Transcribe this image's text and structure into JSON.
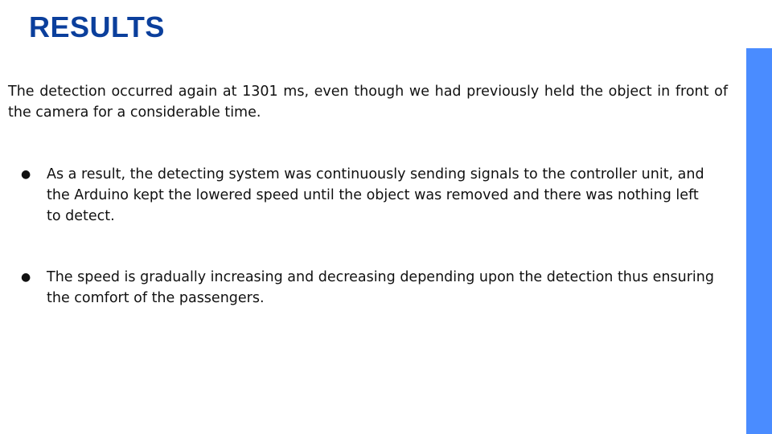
{
  "slide": {
    "title": "RESULTS",
    "intro": "The detection occurred again at 1301 ms, even though we had previously held the object in front of the camera for a considerable time.",
    "bullets": [
      {
        "marker": "●",
        "text": " As a result, the detecting system was continuously sending signals to the controller unit, and the Arduino kept the lowered speed until the object was removed and there was nothing left to detect."
      },
      {
        "marker": "●",
        "text": "The speed is gradually increasing and decreasing depending upon the detection thus ensuring the comfort of the passengers."
      }
    ]
  },
  "colors": {
    "title": "#0b3f9c",
    "side_bar": "#4a8cff",
    "text": "#111111",
    "background": "#ffffff"
  }
}
